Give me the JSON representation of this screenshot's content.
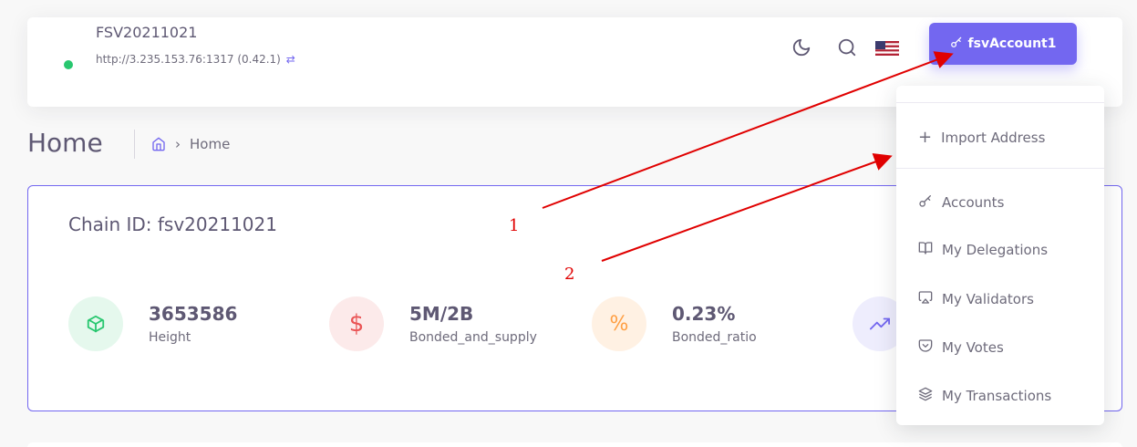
{
  "navbar": {
    "chain_name": "FSV20211021",
    "endpoint": "http://3.235.153.76:1317 (0.42.1)",
    "account_label": "fsvAccount1",
    "icons": [
      "moon-icon",
      "search-icon",
      "us-flag-icon",
      "key-icon"
    ]
  },
  "page": {
    "title": "Home",
    "breadcrumb": {
      "current": "Home"
    }
  },
  "card": {
    "title": "Chain ID: fsv20211021",
    "stats": [
      {
        "value": "3653586",
        "label": "Height",
        "icon": "box-icon",
        "color": "#28c76f"
      },
      {
        "value": "5M/2B",
        "label": "Bonded_and_supply",
        "icon": "dollar-icon",
        "color": "#ea5455"
      },
      {
        "value": "0.23%",
        "label": "Bonded_ratio",
        "icon": "percent-icon",
        "color": "#ff9f43"
      },
      {
        "value": "",
        "label": "",
        "icon": "trending-up-icon",
        "color": "#7367f0"
      }
    ]
  },
  "dropdown": {
    "items": [
      {
        "label": "Import Address",
        "icon": "plus-icon"
      },
      {
        "label": "Accounts",
        "icon": "key-icon"
      },
      {
        "label": "My Delegations",
        "icon": "book-open-icon"
      },
      {
        "label": "My Validators",
        "icon": "airplay-icon"
      },
      {
        "label": "My Votes",
        "icon": "pocket-icon"
      },
      {
        "label": "My Transactions",
        "icon": "layers-icon"
      }
    ]
  },
  "annotations": {
    "label_1": "1",
    "label_2": "2",
    "arrow_color": "#e00000"
  },
  "colors": {
    "primary": "#7367f0",
    "success": "#28c76f",
    "danger": "#ea5455",
    "warning": "#ff9f43"
  }
}
